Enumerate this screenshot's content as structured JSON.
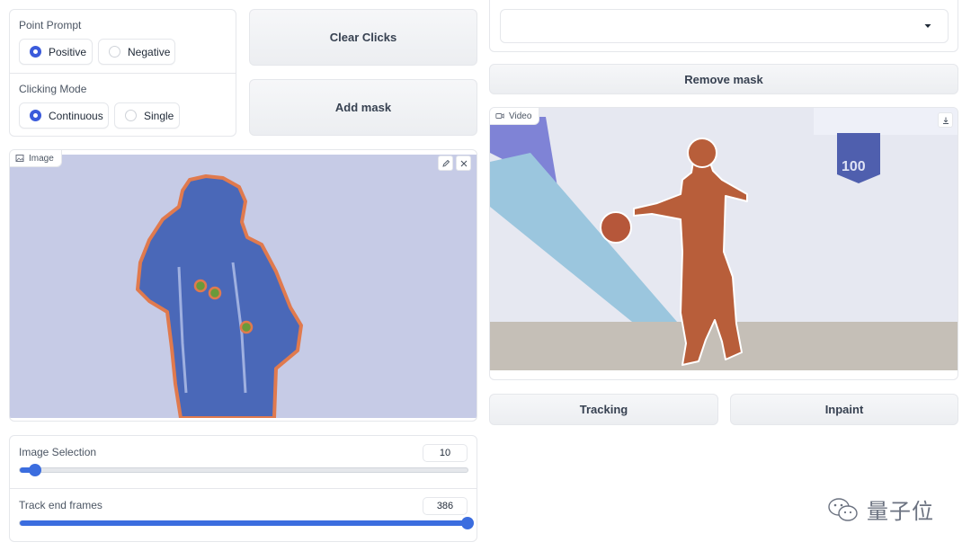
{
  "point_prompt": {
    "label": "Point Prompt",
    "options": [
      {
        "label": "Positive",
        "selected": true
      },
      {
        "label": "Negative",
        "selected": false
      }
    ]
  },
  "clicking_mode": {
    "label": "Clicking Mode",
    "options": [
      {
        "label": "Continuous",
        "selected": true
      },
      {
        "label": "Single",
        "selected": false
      }
    ]
  },
  "buttons": {
    "clear_clicks": "Clear Clicks",
    "add_mask": "Add mask",
    "remove_mask": "Remove mask",
    "tracking": "Tracking",
    "inpaint": "Inpaint"
  },
  "dropdown": {
    "value": ""
  },
  "image_panel": {
    "label": "Image"
  },
  "video_panel": {
    "label": "Video"
  },
  "image_selection": {
    "label": "Image Selection",
    "value": "10",
    "fraction": 0.035
  },
  "track_end_frames": {
    "label": "Track end frames",
    "value": "386",
    "fraction": 1.0
  },
  "watermark": {
    "text": "量子位"
  },
  "colors": {
    "accent": "#3b6ddf",
    "mask_blue": "#4a68b8",
    "mask_orange": "#c2603a"
  }
}
